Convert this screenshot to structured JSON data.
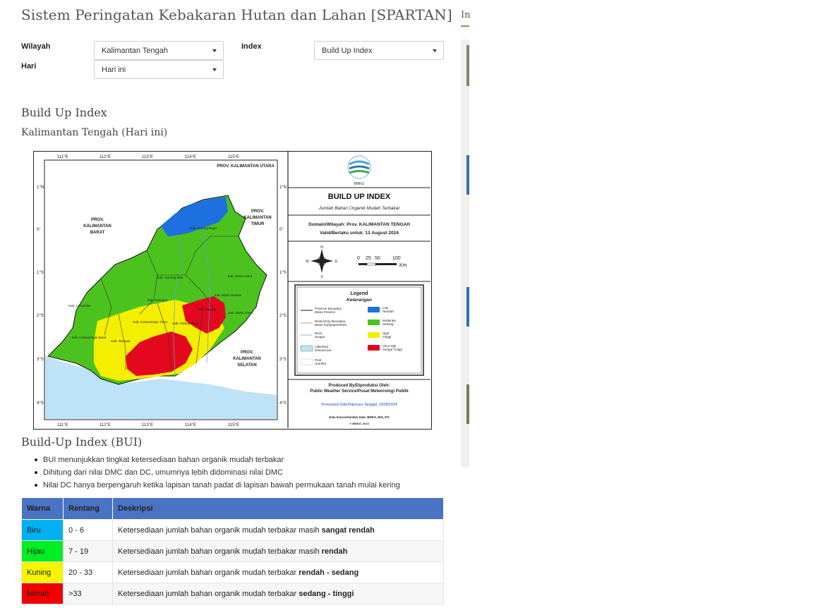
{
  "page": {
    "title": "Sistem Peringatan Kebakaran Hutan dan Lahan [SPARTAN]"
  },
  "filters": {
    "wilayah_label": "Wilayah",
    "wilayah_value": "Kalimantan Tengah",
    "index_label": "Index",
    "index_value": "Build Up Index",
    "hari_label": "Hari",
    "hari_value": "Hari ini"
  },
  "content": {
    "index_title": "Build Up Index",
    "region_subtitle": "Kalimantan Tengah (Hari ini)",
    "bui_title": "Build-Up Index (BUI)",
    "bullets": [
      "BUI menunjukkan tingkat ketersediaan bahan organik mudah terbakar",
      "Dihitung dari nilai DMC dan DC, umumnya lebih didominasi nilai DMC",
      "Nilai DC hanya berpengaruh ketika lapisan tanah padat di lapisan bawah permukaan tanah mulai kering"
    ]
  },
  "map": {
    "lon_ticks": [
      "111°E",
      "112°E",
      "113°E",
      "114°E",
      "115°E"
    ],
    "lat_ticks": [
      "1°N",
      "0°",
      "1°S",
      "2°S",
      "3°S",
      "4°S"
    ],
    "provinces": {
      "kaltara": "PROV. KALIMANTAN UTARA",
      "kalbar_1": "PROV.",
      "kalbar_2": "KALIMANTAN",
      "kalbar_3": "BARAT",
      "kaltim_1": "PROV.",
      "kaltim_2": "KALIMANTAN",
      "kaltim_3": "TIMUR",
      "kalsel_1": "PROV.",
      "kalsel_2": "KALIMANTAN",
      "kalsel_3": "SELATAN"
    },
    "districts": {
      "murung_raya": "Kab. Murung Raya",
      "barito_utara": "Kab. Barito Utara",
      "gunung_mas": "Kab. Gunung Mas",
      "katingan": "Kab. Katingan",
      "lamandau": "Kab. Lamandau",
      "kotawaringin_timur": "Kab. Kotawaringin Timur",
      "kotawaringin_barat": "Kab. Kotawaringin Barat",
      "seruyan": "Kab. Seruyan",
      "kapuas": "Kab. Kapuas",
      "barito_selatan": "Kab. Barito Selatan",
      "barito_timur": "Kab. Barito Timur",
      "pulang_pisau": "Kab. Pulang Pisau"
    },
    "agency": "BMKG",
    "panel_title": "BUILD UP INDEX",
    "panel_subtitle": "Jumlah Bahan Organik Mudah Terbakar",
    "domain_line": "Domain/Wilayah: Prov. KALIMANTAN TENGAH",
    "valid_line": "Valid/Berlaku untuk: 13 August 2024",
    "scale_ticks": [
      "0",
      "25",
      "50",
      "100"
    ],
    "scale_unit": "Km",
    "compass": {
      "n": "N",
      "s": "S",
      "e": "E",
      "w": "W"
    },
    "legend": {
      "title": "Legend",
      "subtitle": "Keterangan",
      "items": [
        {
          "label": "Province Boundary",
          "sub": "Batas Provinsi"
        },
        {
          "label": "District/City Boundary",
          "sub": "Batas Kabupaten/Kota"
        },
        {
          "label": "River",
          "sub": "Sungai"
        },
        {
          "label": "Lake/Sea",
          "sub": "Danau/Laut"
        },
        {
          "label": "Peat",
          "sub": "Gambut"
        },
        {
          "label": "Low",
          "sub": "Rendah"
        },
        {
          "label": "Moderate",
          "sub": "Sedang"
        },
        {
          "label": "High",
          "sub": "Tinggi"
        },
        {
          "label": "Very High",
          "sub": "Sangat Tinggi"
        }
      ]
    },
    "produced_by": "Produced By/Diproduksi Oleh:",
    "produced_org": "Public Weather Service/Pusat Meteorologi Publik",
    "processed_date": "Processed Date/Diproses Tanggal: 13/08/2024",
    "data_source": "Data Source/Sumber Data: BMKG, BIG, IFS",
    "copyright": "© BMKG, 2024"
  },
  "table": {
    "headers": [
      "Warna",
      "Rentang",
      "Deskripsi"
    ],
    "rows": [
      {
        "warna": "Biru",
        "rentang": "0 - 6",
        "desc_prefix": "Ketersediaan jumlah bahan organik mudah terbakar masih ",
        "desc_bold": "sangat rendah",
        "color": "#00b0f0"
      },
      {
        "warna": "Hijau",
        "rentang": "7 - 19",
        "desc_prefix": "Ketersediaan jumlah bahan organik mudah terbakar masih ",
        "desc_bold": "rendah",
        "color": "#00ee22"
      },
      {
        "warna": "Kuning",
        "rentang": "20 - 33",
        "desc_prefix": "Ketersediaan jumlah bahan organik mudah terbakar ",
        "desc_bold": "rendah - sedang",
        "color": "#f5f500"
      },
      {
        "warna": "Merah",
        "rentang": ">33",
        "desc_prefix": "Ketersediaan jumlah bahan organik mudah terbakar ",
        "desc_bold": "sedang - tinggi",
        "color": "#f00000"
      }
    ]
  },
  "sidebar": {
    "tab_label": "In"
  },
  "colors": {
    "low": "#1e6fe0",
    "moderate": "#4cc21f",
    "high": "#f4ef00",
    "very_high": "#e3081d",
    "sea": "#bfe3f6",
    "header": "#4a73c4"
  }
}
